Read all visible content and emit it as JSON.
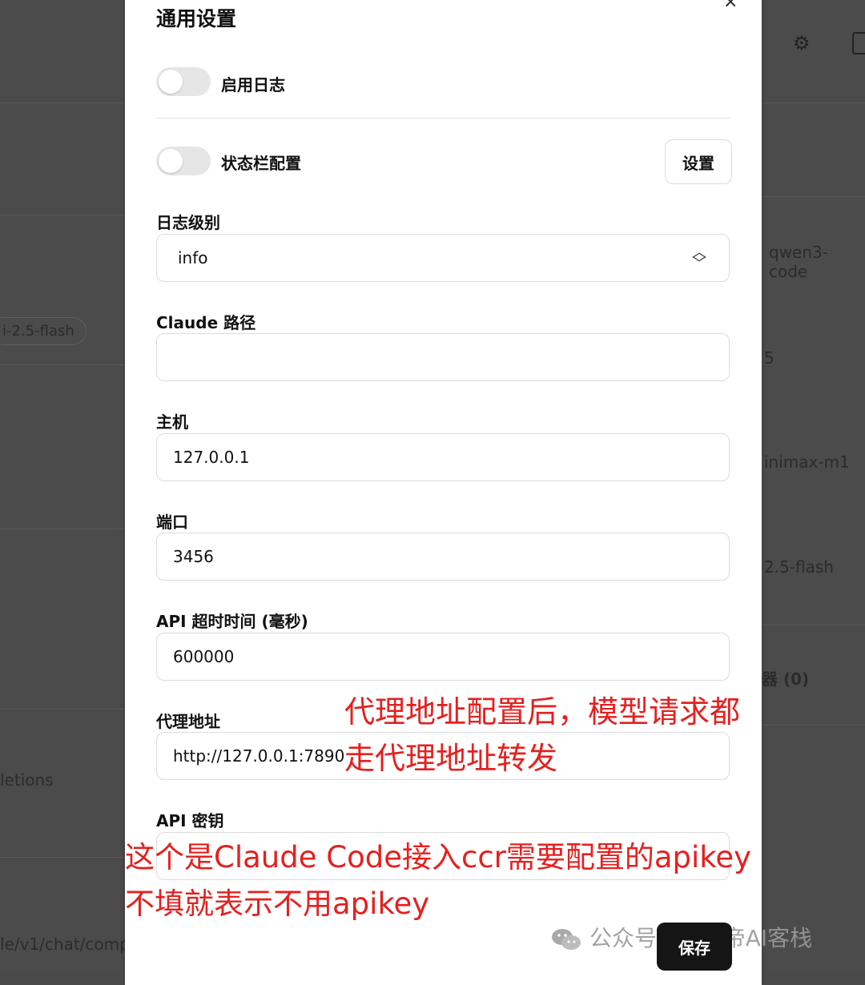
{
  "background": {
    "texts": [
      "qwen3-code",
      "i-2.5-flash",
      "5",
      "inimax-m1",
      "2.5-flash",
      "器 (0)",
      "letions",
      "le/v1/chat/comp"
    ]
  },
  "dialog": {
    "title": "通用设置",
    "close_icon": "×",
    "enable_log_label": "启用日志",
    "statusbar_label": "状态栏配置",
    "settings_button": "设置",
    "log_level_label": "日志级别",
    "log_level_value": "info",
    "claude_path_label": "Claude 路径",
    "claude_path_value": "",
    "host_label": "主机",
    "host_value": "127.0.0.1",
    "port_label": "端口",
    "port_value": "3456",
    "timeout_label": "API 超时时间 (毫秒)",
    "timeout_value": "600000",
    "proxy_label": "代理地址",
    "proxy_value": "http://127.0.0.1:7890",
    "apikey_label": "API 密钥",
    "apikey_value": "",
    "save_button": "保存"
  },
  "annotations": {
    "proxy_line1": "代理地址配置后，模型请求都",
    "proxy_line2": "走代理地址转发",
    "apikey_line1": "这个是Claude Code接入ccr需要配置的apikey",
    "apikey_line2": "不填就表示不用apikey"
  },
  "watermark": {
    "text": "公众号 · 袋鼠帝AI客栈"
  },
  "colors": {
    "annotation": "#e5201f",
    "save_button_bg": "#151515",
    "overlay_bg": "#4b4b4b"
  }
}
